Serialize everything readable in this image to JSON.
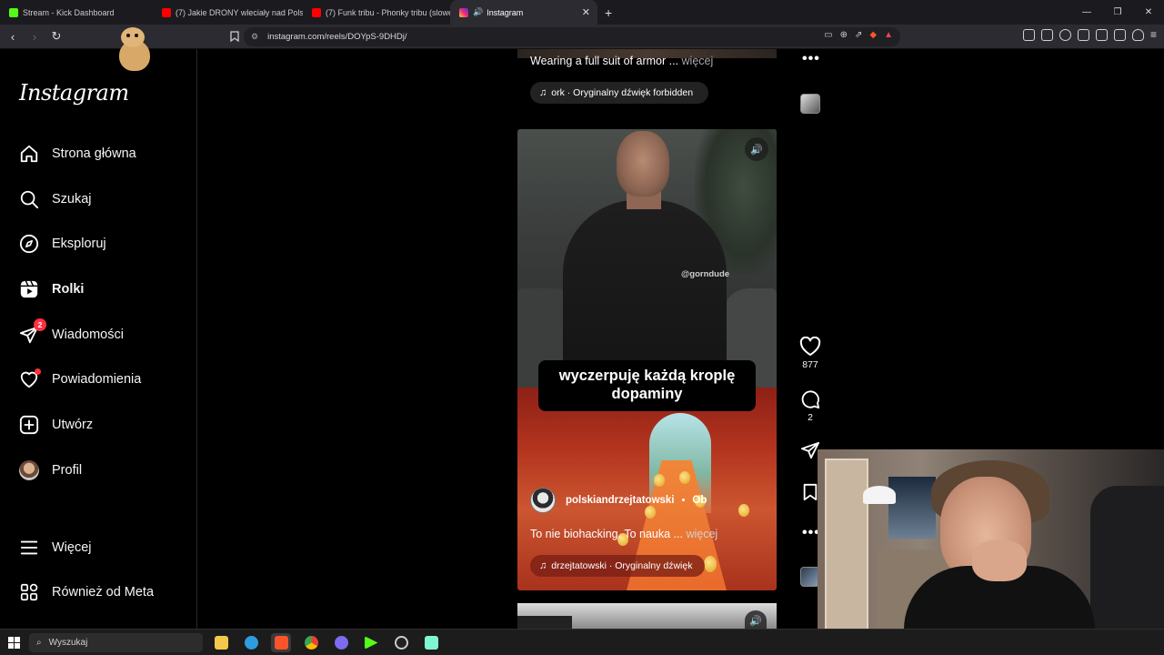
{
  "browser": {
    "tabs": [
      {
        "title": "Stream - Kick Dashboard",
        "favicon_color": "#53fc18"
      },
      {
        "title": "(7) Jakie DRONY wleciały nad Polskę",
        "favicon_color": "#ff0000"
      },
      {
        "title": "(7) Funk tribu - Phonky tribu (slowed",
        "favicon_color": "#ff0000"
      },
      {
        "title": "Instagram",
        "favicon_color": "#e1306c",
        "active": true
      }
    ],
    "new_tab_symbol": "+",
    "url": "instagram.com/reels/DOYpS-9DHDj/"
  },
  "sidebar": {
    "logo": "Instagram",
    "items": [
      {
        "label": "Strona główna",
        "icon": "home-icon"
      },
      {
        "label": "Szukaj",
        "icon": "search-icon"
      },
      {
        "label": "Eksploruj",
        "icon": "compass-icon"
      },
      {
        "label": "Rolki",
        "icon": "reels-icon",
        "active": true
      },
      {
        "label": "Wiadomości",
        "icon": "messages-icon",
        "badge": "2"
      },
      {
        "label": "Powiadomienia",
        "icon": "heart-icon"
      },
      {
        "label": "Utwórz",
        "icon": "create-icon"
      },
      {
        "label": "Profil",
        "icon": "profile-avatar"
      },
      {
        "label": "Więcej",
        "icon": "menu-icon"
      },
      {
        "label": "Również od Meta",
        "icon": "meta-apps-icon"
      }
    ]
  },
  "previous_reel": {
    "caption": "Wearing a full suit of armor ...",
    "more": "więcej",
    "audio": "ork · Oryginalny dźwięk  forbidden"
  },
  "reel": {
    "watermark": "@gorndude",
    "subtitle_line1": "wyczerpuję każdą kroplę",
    "subtitle_line2": "dopaminy",
    "author": "polskiandrzejtatowski",
    "separator": "•",
    "follow": "Ob",
    "caption": "To nie biohacking. To nauka ...",
    "more": "więcej",
    "audio": "drzejtatowski · Oryginalny dźwięk",
    "likes": "877",
    "comments": "2"
  },
  "taskbar": {
    "search_placeholder": "Wyszukaj",
    "apps": [
      {
        "name": "file-explorer-icon",
        "color": "#f2c94c"
      },
      {
        "name": "edge-icon",
        "color": "#2f9ce0"
      },
      {
        "name": "brave-icon",
        "color": "#fb542b"
      },
      {
        "name": "chrome-icon",
        "color": "#4caf50"
      },
      {
        "name": "discord-icon",
        "color": "#7b6cf0"
      },
      {
        "name": "kick-icon",
        "color": "#53fc18"
      },
      {
        "name": "obs-icon",
        "color": "#cccccc"
      },
      {
        "name": "streamlabs-icon",
        "color": "#80f5d2"
      }
    ]
  }
}
